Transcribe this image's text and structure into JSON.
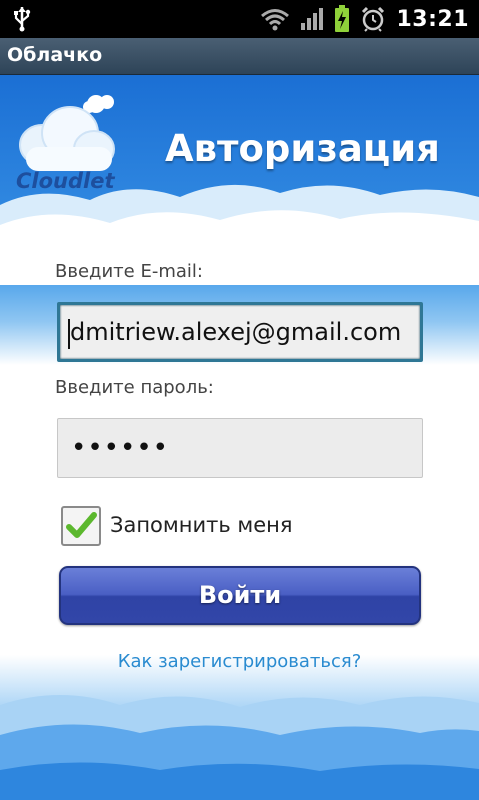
{
  "status_bar": {
    "time": "13:21",
    "icons": [
      "usb-icon",
      "wifi-icon",
      "signal-icon",
      "battery-charging-icon",
      "alarm-icon"
    ]
  },
  "app": {
    "title": "Облачко"
  },
  "logo": {
    "text": "Cloudlet"
  },
  "header": {
    "title": "Авторизация"
  },
  "form": {
    "email_label": "Введите E-mail:",
    "email_value": "dmitriew.alexej@gmail.com",
    "password_label": "Введите пароль:",
    "password_value": "••••••",
    "remember_label": "Запомнить меня",
    "remember_checked": true,
    "login_label": "Войти",
    "register_link": "Как зарегистрироваться?"
  },
  "colors": {
    "sky_blue": "#2f87e0",
    "button_blue": "#3a4fb5",
    "link_blue": "#2a8bd0",
    "check_green": "#5cb82e"
  }
}
